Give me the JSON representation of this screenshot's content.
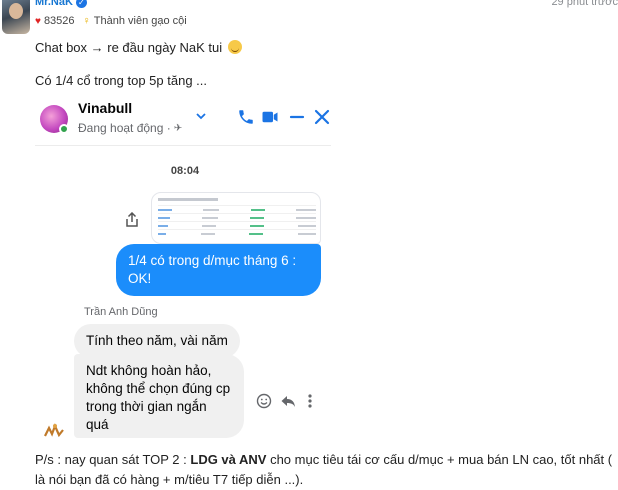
{
  "post": {
    "username": "Mr.NaK",
    "timestamp": "29 phút trước",
    "likes": "83526",
    "rank": "Thành viên gạo cội",
    "line1": "Chat box → re đầu ngày NaK tui",
    "line2": "Có 1/4 cổ trong top 5p tăng ...",
    "ps_prefix": "P/s : nay quan sát TOP 2 : ",
    "ps_bold": "LDG và ANV",
    "ps_suffix": " cho mục tiêu tái cơ cấu d/mục + mua bán LN cao, tốt nhất ( là nói bạn đã có hàng + m/tiêu T7 tiếp diễn ...)."
  },
  "chat": {
    "contact_name": "Vinabull",
    "status": "Đang hoạt động ·",
    "time_separator": "08:04",
    "outgoing_message": "1/4 có trong d/mục tháng  6 : OK!",
    "sender_name": "Trần Anh Dũng",
    "incoming_messages": [
      "Tính theo năm, vài năm",
      "Ndt không hoàn hảo, không thể chọn đúng cp trong thời gian ngắn quá"
    ]
  },
  "colors": {
    "accent": "#1b74e4",
    "bubble_out": "#1b8dfb",
    "bubble_in": "#f0f0f0",
    "username": "#1877d2",
    "online": "#31a24c"
  },
  "icons": [
    "verified-icon",
    "heart-icon",
    "rank-icon",
    "smile-emoji-icon",
    "mute-icon",
    "chevron-down-icon",
    "phone-icon",
    "video-icon",
    "minimize-icon",
    "close-icon",
    "share-icon",
    "react-icon",
    "reply-icon",
    "more-icon"
  ]
}
